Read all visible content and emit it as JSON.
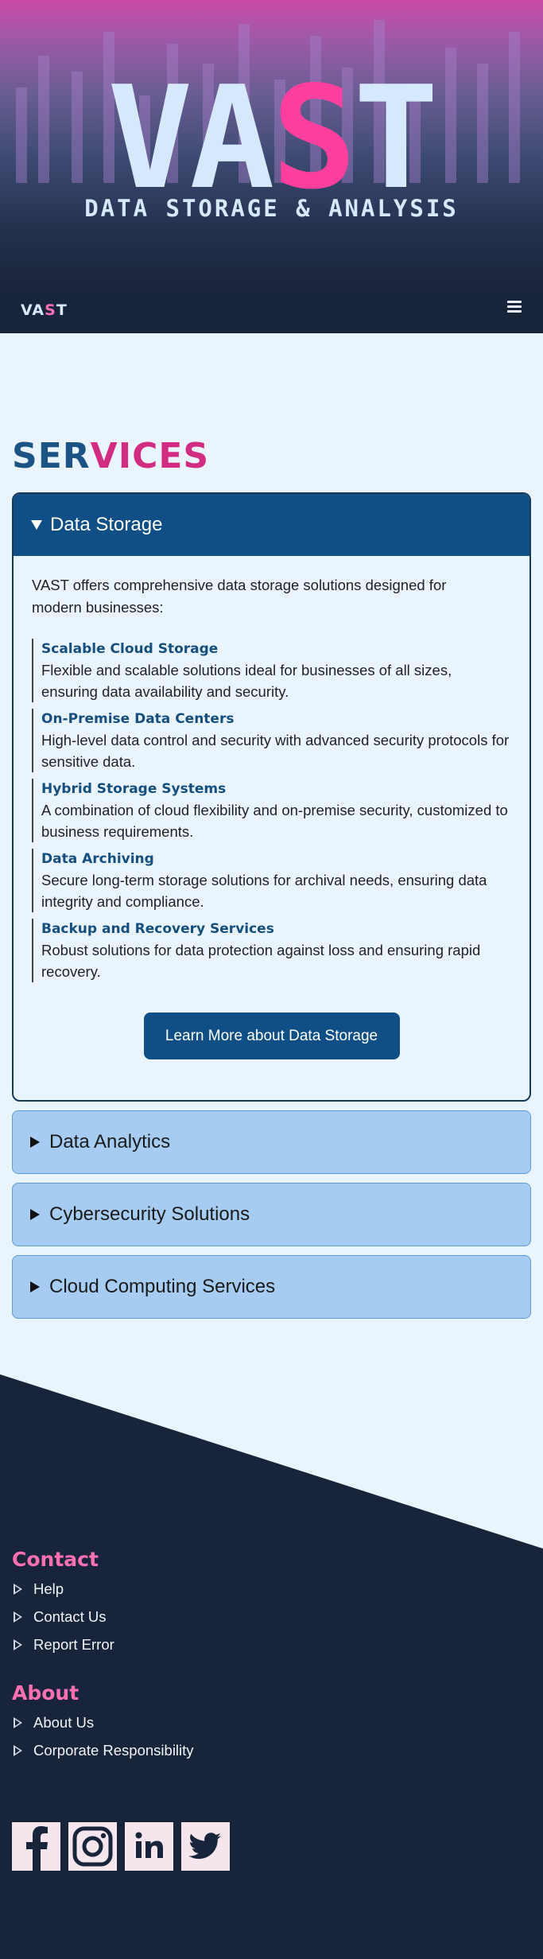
{
  "hero": {
    "title_part1": "VA",
    "title_part2": "S",
    "title_part3": "T",
    "subtitle": "DATA STORAGE & ANALYSIS"
  },
  "nav": {
    "brand_part1": "VA",
    "brand_part2": "S",
    "brand_part3": "T",
    "menu_icon": "hamburger-icon"
  },
  "services": {
    "title_part1": "SER",
    "title_part2": "VICES",
    "open_panel": {
      "title": "Data Storage",
      "intro": "VAST offers comprehensive data storage solutions designed for modern businesses:",
      "features": [
        {
          "title": "Scalable Cloud Storage",
          "desc": "Flexible and scalable solutions ideal for businesses of all sizes, ensuring data availability and security."
        },
        {
          "title": "On-Premise Data Centers",
          "desc": "High-level data control and security with advanced security protocols for sensitive data."
        },
        {
          "title": "Hybrid Storage Systems",
          "desc": "A combination of cloud flexibility and on-premise security, customized to business requirements."
        },
        {
          "title": "Data Archiving",
          "desc": "Secure long-term storage solutions for archival needs, ensuring data integrity and compliance."
        },
        {
          "title": "Backup and Recovery Services",
          "desc": "Robust solutions for data protection against loss and ensuring rapid recovery."
        }
      ],
      "button": "Learn More about Data Storage"
    },
    "closed_panels": [
      "Data Analytics",
      "Cybersecurity Solutions",
      "Cloud Computing Services"
    ]
  },
  "footer": {
    "contact_heading": "Contact",
    "contact_links": [
      "Help",
      "Contact Us",
      "Report Error"
    ],
    "about_heading": "About",
    "about_links": [
      "About Us",
      "Corporate Responsibility"
    ],
    "social_icons": [
      "facebook-icon",
      "instagram-icon",
      "linkedin-icon",
      "twitter-icon"
    ]
  },
  "colors": {
    "primary": "#0f4f86",
    "accent": "#ff3f9d",
    "footer_bg": "#18243a",
    "panel_closed": "#a6cdf1",
    "page_bg": "#eaf4ff"
  }
}
